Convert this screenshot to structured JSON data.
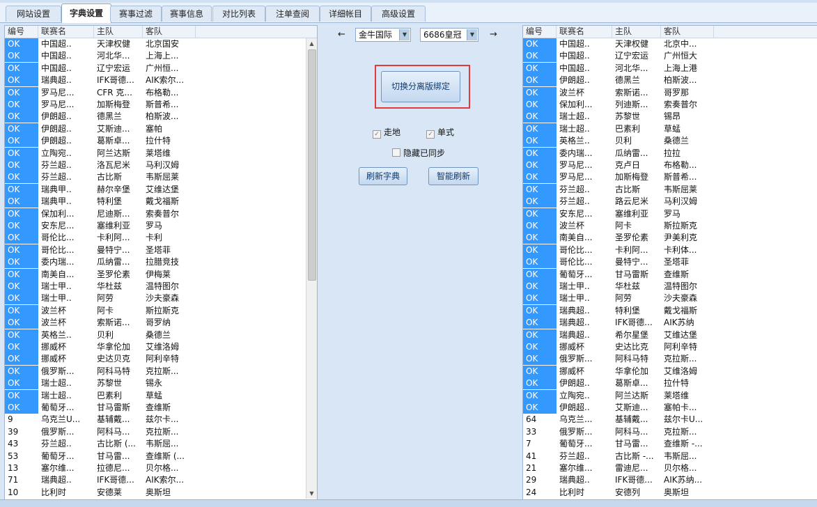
{
  "tabs": [
    {
      "label": "网站设置"
    },
    {
      "label": "字典设置",
      "active": true
    },
    {
      "label": "赛事过滤"
    },
    {
      "label": "赛事信息"
    },
    {
      "label": "对比列表"
    },
    {
      "label": "注单查阅"
    },
    {
      "label": "详细帐目"
    },
    {
      "label": "高级设置"
    }
  ],
  "columns": [
    "编号",
    "联赛名",
    "主队",
    "客队"
  ],
  "left_rows": [
    [
      "OK",
      "中国超..",
      "天津权健",
      "北京国安"
    ],
    [
      "OK",
      "中国超..",
      "河北华...",
      "上海上..."
    ],
    [
      "OK",
      "中国超..",
      "辽宁宏运",
      "广州恒..."
    ],
    [
      "OK",
      "瑞典超..",
      "IFK哥德...",
      "AIK索尔..."
    ],
    [
      "OK",
      "罗马尼...",
      "CFR 克...",
      "布格勒..."
    ],
    [
      "OK",
      "罗马尼...",
      "加斯梅登",
      "斯普希..."
    ],
    [
      "OK",
      "伊朗超..",
      "德黑兰",
      "柏斯波..."
    ],
    [
      "OK",
      "伊朗超..",
      "艾斯迪...",
      "塞帕"
    ],
    [
      "OK",
      "伊朗超..",
      "葛斯卓...",
      "拉什特"
    ],
    [
      "OK",
      "立陶宛..",
      "阿兰达斯",
      "莱塔维"
    ],
    [
      "OK",
      "芬兰超..",
      "洛瓦尼米",
      "马利汉姆"
    ],
    [
      "OK",
      "芬兰超..",
      "古比斯",
      "韦斯屈莱"
    ],
    [
      "OK",
      "瑞典甲..",
      "赫尔辛堡",
      "艾维达堡"
    ],
    [
      "OK",
      "瑞典甲..",
      "特利堡",
      "戴戈福斯"
    ],
    [
      "OK",
      "保加利...",
      "尼迪斯...",
      "索奏普尔"
    ],
    [
      "OK",
      "安东尼...",
      "塞维利亚",
      "罗马"
    ],
    [
      "OK",
      "哥伦比...",
      "卡利阿...",
      "卡利"
    ],
    [
      "OK",
      "哥伦比...",
      "曼特宁...",
      "圣塔菲"
    ],
    [
      "OK",
      "委内瑞...",
      "瓜纳雷...",
      "拉腊竞技"
    ],
    [
      "OK",
      "南美自...",
      "圣罗伦素",
      "伊梅莱"
    ],
    [
      "OK",
      "瑞士甲..",
      "华杜兹",
      "温特图尔"
    ],
    [
      "OK",
      "瑞士甲..",
      "阿劳",
      "沙夫豪森"
    ],
    [
      "OK",
      "波兰杯",
      "阿卡",
      "斯拉斯克"
    ],
    [
      "OK",
      "波兰杯",
      "索斯诺...",
      "哥罗纳"
    ],
    [
      "OK",
      "英格兰..",
      "贝利",
      "桑德兰"
    ],
    [
      "OK",
      "挪威杯",
      "华拿伦加",
      "艾维洛姆"
    ],
    [
      "OK",
      "挪威杯",
      "史达贝克",
      "阿利辛特"
    ],
    [
      "OK",
      "俄罗斯...",
      "阿科马特",
      "克拉斯..."
    ],
    [
      "OK",
      "瑞士超..",
      "苏黎世",
      "锡永"
    ],
    [
      "OK",
      "瑞士超..",
      "巴素利",
      "草蜢"
    ],
    [
      "OK",
      "葡萄牙...",
      "甘马雷斯",
      "查维斯"
    ],
    [
      "9",
      "乌克兰U...",
      "基辅戴...",
      "兹尔卡..."
    ],
    [
      "39",
      "俄罗斯...",
      "阿科马...",
      "克拉斯..."
    ],
    [
      "43",
      "芬兰超..",
      "古比斯 (...",
      "韦斯屈..."
    ],
    [
      "53",
      "葡萄牙...",
      "甘马雷...",
      "查维斯 (..."
    ],
    [
      "13",
      "塞尔维...",
      "拉德尼...",
      "贝尔格..."
    ],
    [
      "71",
      "瑞典超..",
      "IFK哥德...",
      "AIK索尔..."
    ],
    [
      "10",
      "比利时",
      "安德莱",
      "奥斯坦"
    ]
  ],
  "right_rows": [
    [
      "OK",
      "中国超..",
      "天津权健",
      "北京中..."
    ],
    [
      "OK",
      "中国超..",
      "辽宁宏运",
      "广州恒大"
    ],
    [
      "OK",
      "中国超..",
      "河北华...",
      "上海上港"
    ],
    [
      "OK",
      "伊朗超..",
      "德黑兰",
      "柏斯波..."
    ],
    [
      "OK",
      "波兰杯",
      "索斯诺...",
      "哥罗那"
    ],
    [
      "OK",
      "保加利...",
      "列迪斯...",
      "索奏普尔"
    ],
    [
      "OK",
      "瑞士超..",
      "苏黎世",
      "锡昂"
    ],
    [
      "OK",
      "瑞士超..",
      "巴素利",
      "草蜢"
    ],
    [
      "OK",
      "英格兰..",
      "贝利",
      "桑德兰"
    ],
    [
      "OK",
      "委内瑞...",
      "瓜纳雷...",
      "拉拉"
    ],
    [
      "OK",
      "罗马尼...",
      "克卢日",
      "布格勒..."
    ],
    [
      "OK",
      "罗马尼...",
      "加斯梅登",
      "斯普希..."
    ],
    [
      "OK",
      "芬兰超..",
      "古比斯",
      "韦斯屈莱"
    ],
    [
      "OK",
      "芬兰超..",
      "路云尼米",
      "马利汉姆"
    ],
    [
      "OK",
      "安东尼...",
      "塞维利亚",
      "罗马"
    ],
    [
      "OK",
      "波兰杯",
      "阿卡",
      "斯拉斯克"
    ],
    [
      "OK",
      "南美自...",
      "圣罗伦素",
      "尹美利克"
    ],
    [
      "OK",
      "哥伦比...",
      "卡利阿...",
      "卡利体..."
    ],
    [
      "OK",
      "哥伦比...",
      "曼特宁...",
      "圣塔菲"
    ],
    [
      "OK",
      "葡萄牙...",
      "甘马雷斯",
      "查维斯"
    ],
    [
      "OK",
      "瑞士甲..",
      "华杜兹",
      "温特图尔"
    ],
    [
      "OK",
      "瑞士甲..",
      "阿劳",
      "沙夫豪森"
    ],
    [
      "OK",
      "瑞典超..",
      "特利堡",
      "戴戈福斯"
    ],
    [
      "OK",
      "瑞典超..",
      "IFK哥德...",
      "AIK苏纳"
    ],
    [
      "OK",
      "瑞典超..",
      "希尔星堡",
      "艾维达堡"
    ],
    [
      "OK",
      "挪威杯",
      "史达比克",
      "阿利辛特"
    ],
    [
      "OK",
      "俄罗斯...",
      "阿科马特",
      "克拉斯..."
    ],
    [
      "OK",
      "挪威杯",
      "华拿伦加",
      "艾维洛姆"
    ],
    [
      "OK",
      "伊朗超..",
      "葛斯卓...",
      "拉什特"
    ],
    [
      "OK",
      "立陶宛..",
      "阿兰达斯",
      "莱塔维"
    ],
    [
      "OK",
      "伊朗超..",
      "艾斯迪...",
      "塞帕卡..."
    ],
    [
      "64",
      "乌克兰...",
      "基辅戴...",
      "兹尔卡U..."
    ],
    [
      "33",
      "俄罗斯...",
      "阿科马...",
      "克拉斯..."
    ],
    [
      "7",
      "葡萄牙...",
      "甘马雷...",
      "查维斯 -..."
    ],
    [
      "41",
      "芬兰超..",
      "古比斯 -...",
      "韦斯屈..."
    ],
    [
      "21",
      "塞尔维...",
      "雷迪尼...",
      "贝尔格..."
    ],
    [
      "29",
      "瑞典超..",
      "IFK哥德...",
      "AIK苏纳..."
    ],
    [
      "24",
      "比利时",
      "安德列",
      "奥斯坦"
    ]
  ],
  "center": {
    "left_arrow": "←",
    "right_arrow": "→",
    "site_a": "金牛国际",
    "site_b": "6686皇冠",
    "dropdown_glyph": "▼",
    "switch_label": "切换分离版绑定",
    "walk_label": "走地",
    "single_label": "单式",
    "hide_synced_label": "隐藏已同步",
    "check_glyph": "✓",
    "refresh_dict_label": "刷新字典",
    "smart_refresh_label": "智能刷新",
    "walk_checked": true,
    "single_checked": true,
    "hide_synced_checked": false
  },
  "colors": {
    "ok_cell": "#3399ff",
    "highlight_box": "#e03a3a",
    "panel_bg": "#d8e6f5"
  }
}
